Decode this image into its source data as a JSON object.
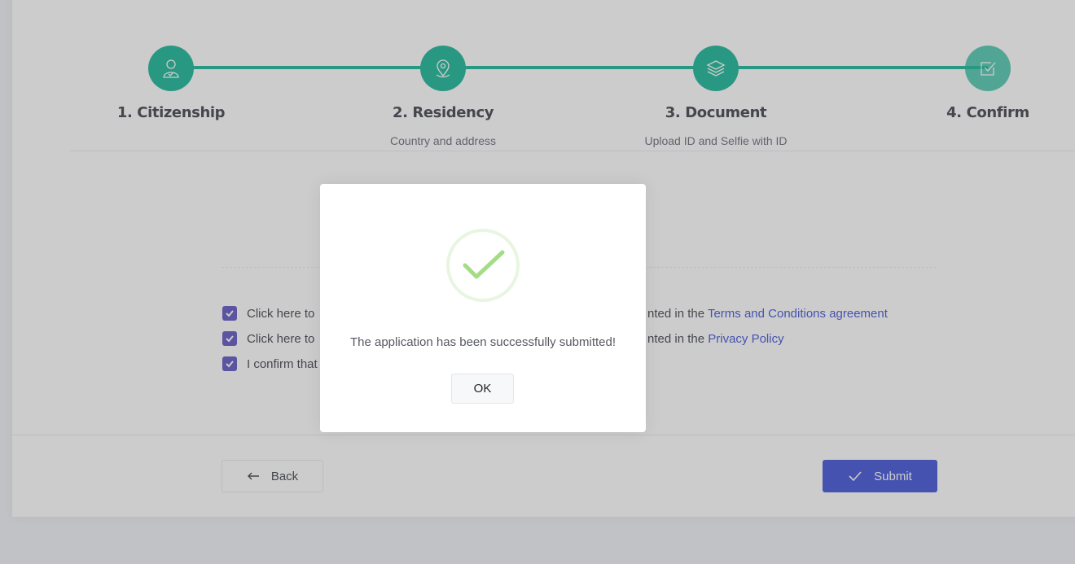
{
  "steps": [
    {
      "title": "1. Citizenship",
      "subtitle": "",
      "icon": "user-check-icon"
    },
    {
      "title": "2. Residency",
      "subtitle": "Country and address",
      "icon": "map-pin-icon"
    },
    {
      "title": "3. Document",
      "subtitle": "Upload ID and Selfie with ID",
      "icon": "layers-icon"
    },
    {
      "title": "4. Confirm",
      "subtitle": "",
      "icon": "checkbox-icon"
    }
  ],
  "agreements": [
    {
      "text_visible": "Click here to",
      "tail_visible": "nted in the ",
      "link": "Terms and Conditions agreement",
      "checked": true
    },
    {
      "text_visible": "Click here to",
      "tail_visible": "nted in the ",
      "link": "Privacy Policy",
      "checked": true
    },
    {
      "text_visible": "I confirm that",
      "checked": true
    }
  ],
  "actions": {
    "back_label": "Back",
    "submit_label": "Submit"
  },
  "modal": {
    "message": "The application has been successfully submitted!",
    "ok_label": "OK"
  },
  "colors": {
    "accent": "#34bfa3",
    "primary": "#5867dd",
    "checkbox": "#716aca",
    "success": "#a5dc86"
  }
}
